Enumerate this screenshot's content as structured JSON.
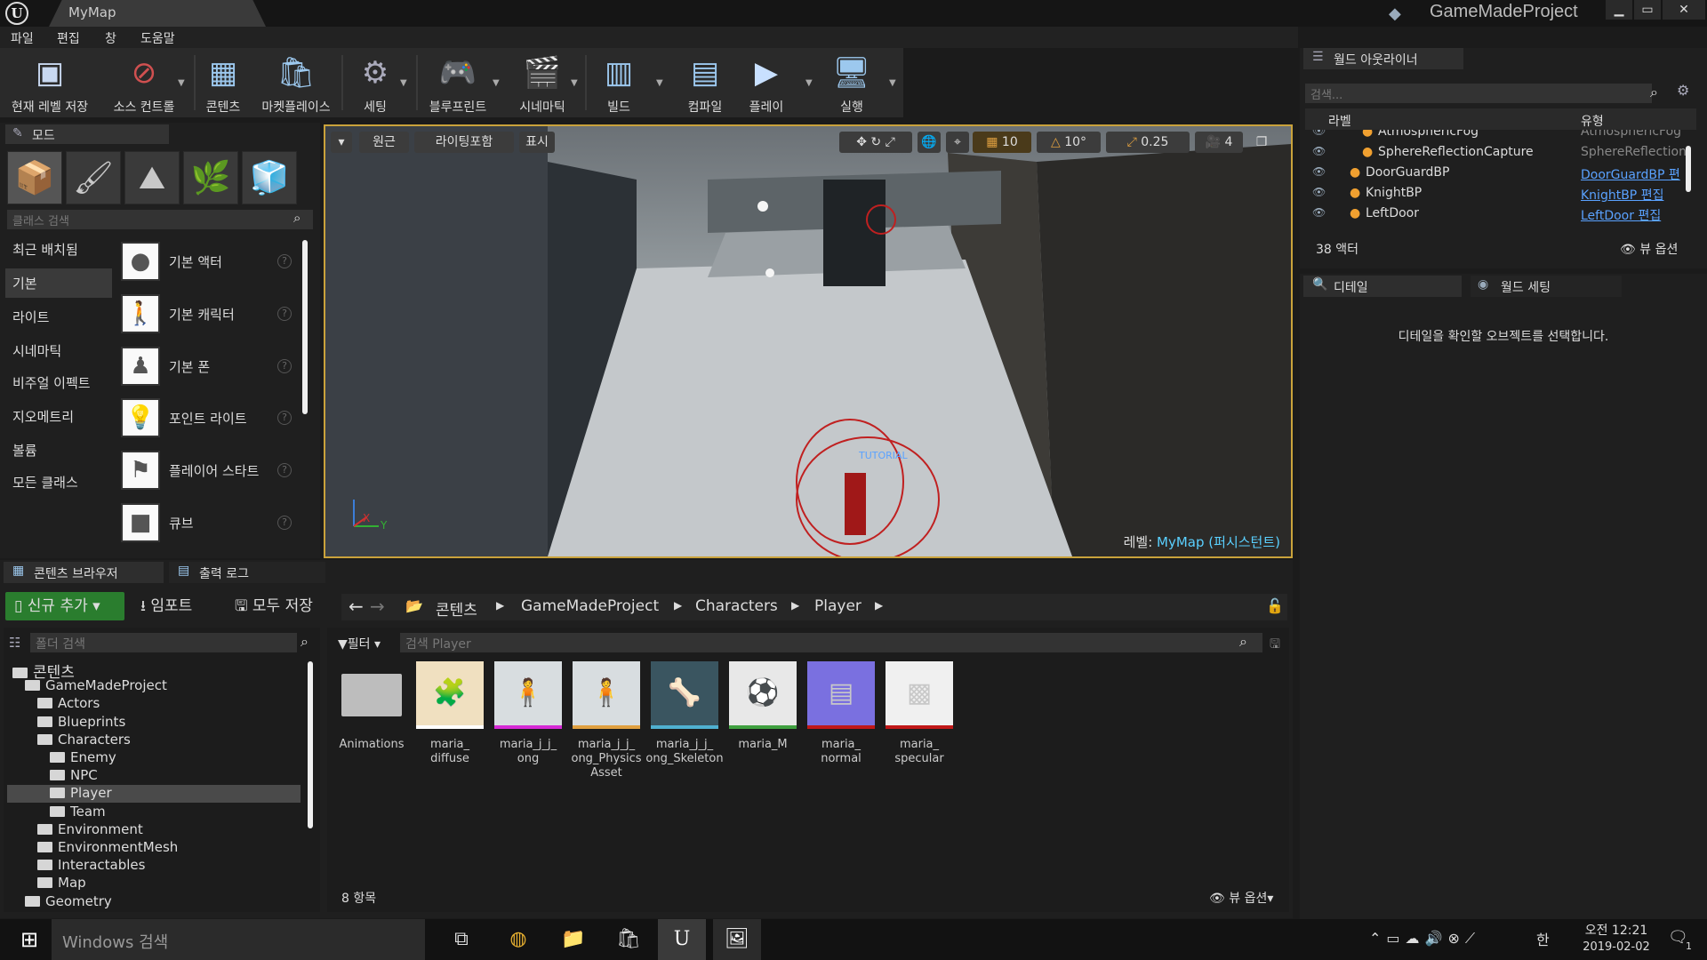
{
  "window": {
    "doc_tab": "MyMap",
    "project_name": "GameMadeProject"
  },
  "menu": [
    "파일",
    "편집",
    "창",
    "도움말"
  ],
  "toolbar": [
    {
      "label": "현재 레벨 저장",
      "icon": "save-icon"
    },
    {
      "label": "소스 컨트롤",
      "icon": "source-control-icon"
    },
    {
      "label": "콘텐츠",
      "icon": "content-icon"
    },
    {
      "label": "마켓플레이스",
      "icon": "marketplace-icon"
    },
    {
      "label": "세팅",
      "icon": "settings-icon"
    },
    {
      "label": "블루프린트",
      "icon": "blueprint-icon"
    },
    {
      "label": "시네마틱",
      "icon": "cinematic-icon"
    },
    {
      "label": "빌드",
      "icon": "build-icon"
    },
    {
      "label": "컴파일",
      "icon": "compile-icon"
    },
    {
      "label": "플레이",
      "icon": "play-icon"
    },
    {
      "label": "실행",
      "icon": "launch-icon"
    }
  ],
  "modes": {
    "tab_label": "모드",
    "search_placeholder": "클래스 검색",
    "categories": [
      "최근 배치됨",
      "기본",
      "라이트",
      "시네마틱",
      "비주얼 이펙트",
      "지오메트리",
      "볼륨",
      "모든 클래스"
    ],
    "selected_category": "기본",
    "assets": [
      "기본 액터",
      "기본 캐릭터",
      "기본 폰",
      "포인트 라이트",
      "플레이어 스타트",
      "큐브"
    ]
  },
  "viewport": {
    "perspective": "원근",
    "view_mode": "라이팅포함",
    "show": "표시",
    "grid_snap": "10",
    "rotation_snap": "10°",
    "scale_snap": "0.25",
    "camera_speed": "4",
    "level_label": "레벨:",
    "level_name": "MyMap (퍼시스턴트)",
    "tutorial_text": "TUTORIAL",
    "axis_x": "X",
    "axis_y": "Y"
  },
  "outliner": {
    "tab_label": "월드 아웃라이너",
    "search_placeholder": "검색...",
    "col_label": "라벨",
    "col_type": "유형",
    "rows": [
      {
        "label": "AtmosphericFog",
        "type": "AtmosphericFog",
        "link": false
      },
      {
        "label": "SphereReflectionCapture",
        "type": "SphereReflection",
        "link": false
      },
      {
        "label": "DoorGuardBP",
        "type": "DoorGuardBP 편",
        "link": true
      },
      {
        "label": "KnightBP",
        "type": "KnightBP 편집",
        "link": true
      },
      {
        "label": "LeftDoor",
        "type": "LeftDoor 편집",
        "link": true
      }
    ],
    "actor_count": "38 액터",
    "view_options": "뷰 옵션"
  },
  "details": {
    "tab_details": "디테일",
    "tab_world": "월드 세팅",
    "empty_message": "디테일을 확인할 오브젝트를 선택합니다."
  },
  "content_browser": {
    "tab_browser": "콘텐츠 브라우저",
    "tab_log": "출력 로그",
    "add_new": "신규 추가",
    "import": "임포트",
    "save_all": "모두 저장",
    "breadcrumb": [
      "콘텐츠",
      "GameMadeProject",
      "Characters",
      "Player"
    ],
    "folder_search": "폴더 검색",
    "filter": "필터",
    "asset_search": "검색 Player",
    "tree": [
      {
        "label": "콘텐츠",
        "depth": 0
      },
      {
        "label": "GameMadeProject",
        "depth": 1
      },
      {
        "label": "Actors",
        "depth": 2
      },
      {
        "label": "Blueprints",
        "depth": 2
      },
      {
        "label": "Characters",
        "depth": 2
      },
      {
        "label": "Enemy",
        "depth": 3
      },
      {
        "label": "NPC",
        "depth": 3
      },
      {
        "label": "Player",
        "depth": 3
      },
      {
        "label": "Team",
        "depth": 3
      },
      {
        "label": "Environment",
        "depth": 2
      },
      {
        "label": "EnvironmentMesh",
        "depth": 2
      },
      {
        "label": "Interactables",
        "depth": 2
      },
      {
        "label": "Map",
        "depth": 2
      },
      {
        "label": "Geometry",
        "depth": 1
      }
    ],
    "selected_folder": "Player",
    "assets": [
      {
        "name": "Animations",
        "color": "#bdbdbd"
      },
      {
        "name": "maria_ diffuse",
        "color": "#ffffff"
      },
      {
        "name": "maria_j_j_ ong",
        "color": "#d52ad5"
      },
      {
        "name": "maria_j_j_ ong_Physics Asset",
        "color": "#e0a040"
      },
      {
        "name": "maria_j_j_ ong_Skeleton",
        "color": "#4fb0d0"
      },
      {
        "name": "maria_M",
        "color": "#3fa03f"
      },
      {
        "name": "maria_ normal",
        "color": "#c01818"
      },
      {
        "name": "maria_ specular",
        "color": "#c01818"
      }
    ],
    "item_count": "8 항목",
    "view_options": "뷰 옵션"
  },
  "taskbar": {
    "search": "Windows 검색",
    "ime": "한",
    "time": "오전 12:21",
    "date": "2019-02-02",
    "notification_count": "1"
  },
  "colors": {
    "accent": "#c9a23b",
    "link": "#5aa2ff",
    "add_button": "#2a7d2e"
  }
}
